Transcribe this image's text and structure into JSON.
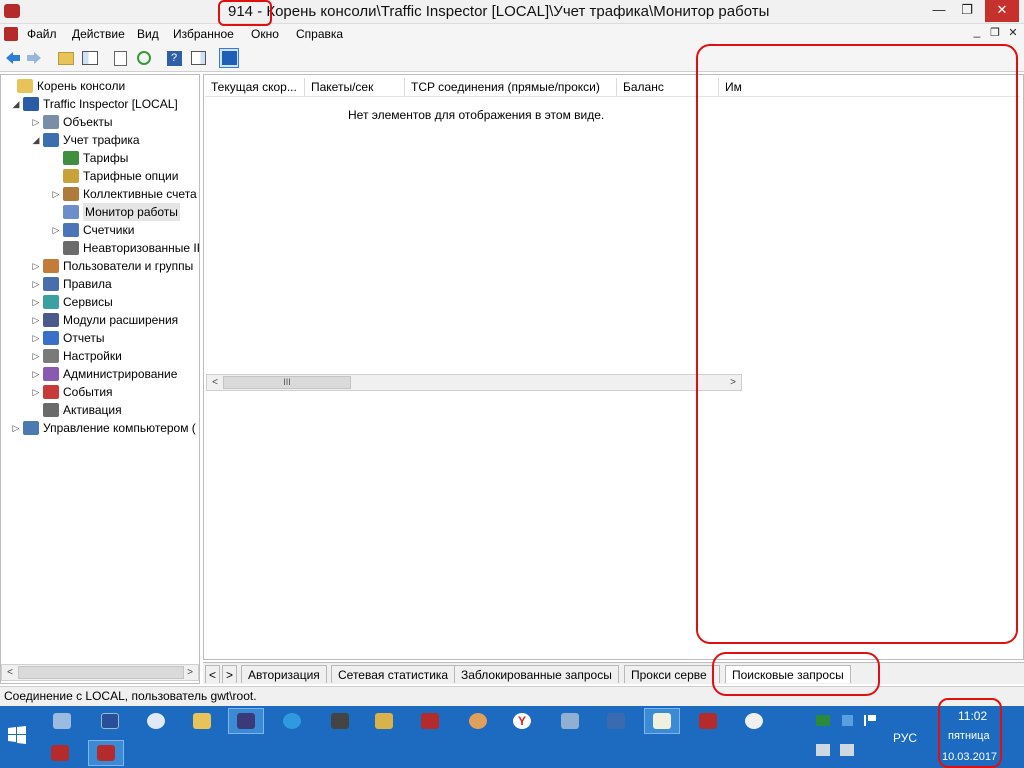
{
  "window": {
    "title": "914 - Корень консоли\\Traffic Inspector [LOCAL]\\Учет трафика\\Монитор работы",
    "minimize": "—",
    "restore": "❐",
    "close": "✕",
    "inner_min": "_",
    "inner_restore": "❐",
    "inner_close": "✕"
  },
  "menu": [
    "Файл",
    "Действие",
    "Вид",
    "Избранное",
    "Окно",
    "Справка"
  ],
  "tree": [
    {
      "label": "Корень консоли",
      "icon": "folder-icon",
      "color": "#e8c35a",
      "exp": "",
      "level": 0
    },
    {
      "label": "Traffic Inspector [LOCAL]",
      "icon": "traffic-inspector-icon",
      "color": "#2b5aa6",
      "exp": "◢",
      "level": 1
    },
    {
      "label": "Объекты",
      "icon": "objects-icon",
      "color": "#7b8ea8",
      "exp": "▷",
      "level": 2
    },
    {
      "label": "Учет трафика",
      "icon": "traffic-accounting-icon",
      "color": "#3d6fb0",
      "exp": "◢",
      "level": 2
    },
    {
      "label": "Тарифы",
      "icon": "tariffs-icon",
      "color": "#3f8f3f",
      "exp": "",
      "level": 3
    },
    {
      "label": "Тарифные опции",
      "icon": "tariff-options-icon",
      "color": "#c9a23a",
      "exp": "",
      "level": 3
    },
    {
      "label": "Коллективные счета",
      "icon": "collective-accounts-icon",
      "color": "#b07a3a",
      "exp": "▷",
      "level": 3
    },
    {
      "label": "Монитор работы",
      "icon": "monitor-icon",
      "color": "#6a8fc9",
      "exp": "",
      "level": 3,
      "selected": true
    },
    {
      "label": "Счетчики",
      "icon": "counters-icon",
      "color": "#4a76b8",
      "exp": "▷",
      "level": 3
    },
    {
      "label": "Неавторизованные IP",
      "icon": "unauthorized-ip-icon",
      "color": "#6b6b6b",
      "exp": "",
      "level": 3
    },
    {
      "label": "Пользователи и группы",
      "icon": "users-icon",
      "color": "#c47b3a",
      "exp": "▷",
      "level": 2
    },
    {
      "label": "Правила",
      "icon": "rules-icon",
      "color": "#4a6db0",
      "exp": "▷",
      "level": 2
    },
    {
      "label": "Сервисы",
      "icon": "services-icon",
      "color": "#3aa0a0",
      "exp": "▷",
      "level": 2
    },
    {
      "label": "Модули расширения",
      "icon": "extensions-icon",
      "color": "#4a5a8a",
      "exp": "▷",
      "level": 2
    },
    {
      "label": "Отчеты",
      "icon": "reports-icon",
      "color": "#3a6fc9",
      "exp": "▷",
      "level": 2
    },
    {
      "label": "Настройки",
      "icon": "settings-icon",
      "color": "#7a7a7a",
      "exp": "▷",
      "level": 2
    },
    {
      "label": "Администрирование",
      "icon": "administration-icon",
      "color": "#8a5ab0",
      "exp": "▷",
      "level": 2
    },
    {
      "label": "События",
      "icon": "events-icon",
      "color": "#c93a3a",
      "exp": "▷",
      "level": 2
    },
    {
      "label": "Активация",
      "icon": "activation-icon",
      "color": "#6a6a6a",
      "exp": "",
      "level": 2
    },
    {
      "label": "Управление компьютером (",
      "icon": "computer-management-icon",
      "color": "#4a7ab0",
      "exp": "▷",
      "level": 1
    }
  ],
  "columns": [
    "Текущая скор...",
    "Пакеты/сек",
    "TCP соединения (прямые/прокси)",
    "Баланс",
    "Им"
  ],
  "empty_message": "Нет элементов для отображения в этом виде.",
  "scroll": {
    "left": "<",
    "right": ">",
    "thumb": "III"
  },
  "tabs": {
    "nav_prev": "<",
    "nav_next": ">",
    "items": [
      "Авторизация",
      "Сетевая статистика",
      "Заблокированные запросы",
      "Прокси серве",
      "Поисковые запросы"
    ]
  },
  "status": "Соединение с LOCAL, пользователь gwt\\root.",
  "taskbar": {
    "lang": "РУС",
    "time": "11:02",
    "day": "пятница",
    "date": "10.03.2017"
  },
  "colors": {
    "taskbar": "#1c6bc0",
    "annotation": "#e01010",
    "selection": "#e5e5e5"
  }
}
